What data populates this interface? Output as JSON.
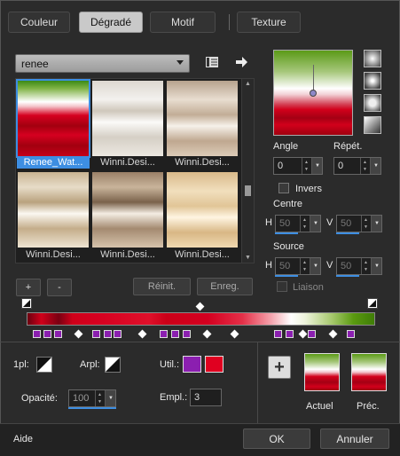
{
  "tabs": [
    {
      "label": "Couleur"
    },
    {
      "label": "Dégradé"
    },
    {
      "label": "Motif"
    },
    {
      "label": "Texture"
    }
  ],
  "gradient_dropdown": {
    "value": "renee"
  },
  "gallery": {
    "items": [
      {
        "label": "Renee_Wat..."
      },
      {
        "label": "Winni.Desi..."
      },
      {
        "label": "Winni.Desi..."
      },
      {
        "label": "Winni.Desi..."
      },
      {
        "label": "Winni.Desi..."
      },
      {
        "label": "Winni.Desi..."
      }
    ]
  },
  "angle": {
    "label": "Angle",
    "value": "0"
  },
  "repeat": {
    "label": "Répét.",
    "value": "0"
  },
  "invert": {
    "label": "Invers"
  },
  "centre": {
    "label": "Centre",
    "h_label": "H",
    "h_value": "50",
    "v_label": "V",
    "v_value": "50"
  },
  "source": {
    "label": "Source",
    "h_label": "H",
    "h_value": "50",
    "v_label": "V",
    "v_value": "50"
  },
  "link": {
    "label": "Liaison"
  },
  "buttons": {
    "add": "+",
    "remove": "-",
    "reset": "Réinit.",
    "save": "Enreg."
  },
  "stop_props": {
    "ipl_label": "1pl:",
    "arpl_label": "Arpl:",
    "util_label": "Util.:",
    "opacity_label": "Opacité:",
    "opacity_value": "100",
    "empl_label": "Empl.:",
    "empl_value": "3"
  },
  "swatches": {
    "current_label": "Actuel",
    "previous_label": "Préc.",
    "plus": "+"
  },
  "footer": {
    "help": "Aide",
    "ok": "OK",
    "cancel": "Annuler"
  },
  "colors": {
    "accent": "#3d8ee2",
    "stop_purple": "#8b1fb0",
    "red": "#d2001b",
    "green": "#5b9a17"
  }
}
